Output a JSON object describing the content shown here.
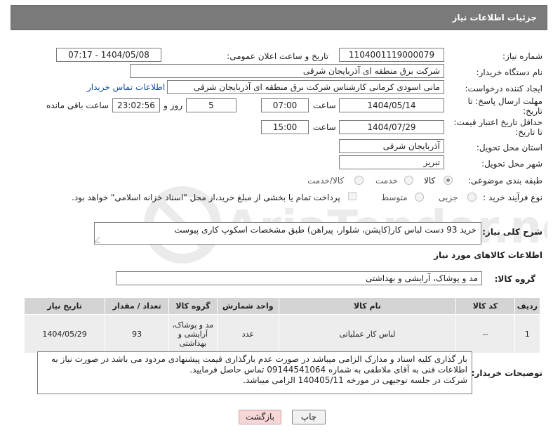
{
  "header": {
    "title": "جزئیات اطلاعات نیاز"
  },
  "fields": {
    "need_number": {
      "label": "شماره نیاز:",
      "value": "1104001119000079"
    },
    "announce_datetime": {
      "label": "تاریخ و ساعت اعلان عمومی:",
      "value": "1404/05/08 - 07:17"
    },
    "buyer_org": {
      "label": "نام دستگاه خریدار:",
      "value": "شرکت برق منطقه ای آذربایجان شرقی"
    },
    "requester": {
      "label": "ایجاد کننده درخواست:",
      "value": "مانی اسودی کرمانی کارشناس شرکت برق منطقه ای آذربایجان شرقی",
      "contact_link": "اطلاعات تماس خریدار"
    },
    "reply_deadline": {
      "label_line1": "مهلت ارسال پاسخ: تا",
      "label_line2": "تاریخ:",
      "date": "1404/05/14",
      "time_label": "ساعت",
      "time": "07:00",
      "days": "5",
      "days_label": "روز و",
      "remaining": "23:02:56",
      "remaining_label": "ساعت باقی مانده"
    },
    "price_validity": {
      "label_line1": "حداقل تاریخ اعتبار قیمت:",
      "label_line2": "تا تاریخ:",
      "date": "1404/07/29",
      "time_label": "ساعت",
      "time": "15:00"
    },
    "delivery_province": {
      "label": "استان محل تحویل:",
      "value": "آذربایجان شرقی"
    },
    "delivery_city": {
      "label": "شهر محل تحویل:",
      "value": "تبریز"
    },
    "category": {
      "label": "طبقه بندی موضوعی:",
      "options": [
        "کالا",
        "خدمت",
        "کالا/خدمت"
      ],
      "selected": "کالا"
    },
    "purchase_type": {
      "label": "نوع فرآیند خرید :",
      "options": [
        "جزیی",
        "متوسط"
      ],
      "selected": "",
      "payment_note": "پرداخت تمام یا بخشی از مبلغ خرید،از محل \"اسناد خزانه اسلامی\" خواهد بود."
    },
    "description": {
      "label": "شرح کلی نیاز:",
      "value": "خرید 93 دست لباس کار(کاپشن، شلوار، پیراهن) طبق مشخصات اسکوپ کاری پیوست"
    }
  },
  "goods": {
    "section_title": "اطلاعات کالاهای مورد نیاز",
    "group_label": "گروه کالا:",
    "group_value": "مد و پوشاک، آرایشی و بهداشتی",
    "columns": [
      "ردیف",
      "کد کالا",
      "نام کالا",
      "واحد شمارش",
      "گروه کالا",
      "تعداد / مقدار",
      "تاریخ نیاز"
    ],
    "rows": [
      {
        "row": "1",
        "code": "--",
        "name": "لباس کار عملیاتی",
        "unit": "عدد",
        "group": "مد و پوشاک، آرایشی و بهداشتی",
        "qty": "93",
        "date": "1404/05/29"
      }
    ]
  },
  "buyer_notes": {
    "label": "توضیحات خریدار:",
    "line1": "بار گذاری کلیه اسناد و مدارک الزامی میباشد در صورت عدم بارگذاری قیمت پیشنهادی مردود می باشد در صورت نیاز به",
    "line2": "اطلاعات فنی به آقای ملاطفی به شماره 09144541064 تماس حاصل فرمایید.",
    "line3": "شرکت در جلسه توجیهی در مورخه 140405/11 الزامی میباشد."
  },
  "buttons": {
    "print": "چاپ",
    "back": "بازگشت"
  },
  "watermark": {
    "text": "AriaTender.net"
  },
  "colors": {
    "header_bg": "#7a7a7a",
    "link": "#1a4f9c",
    "back_button_bg": "#f6d6d6"
  }
}
